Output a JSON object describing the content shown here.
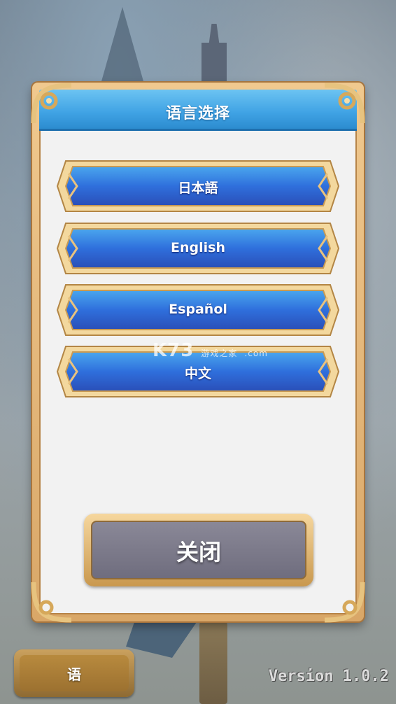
{
  "dialog": {
    "title": "语言选择",
    "languages": [
      {
        "label": "日本語"
      },
      {
        "label": "English"
      },
      {
        "label": "Español"
      },
      {
        "label": "中文"
      }
    ],
    "close_label": "关闭"
  },
  "footer": {
    "language_button_label": "语",
    "version": "Version 1.0.2"
  },
  "watermark": {
    "brand": "K73",
    "sub": "游戏之家",
    "domain": ".com"
  },
  "colors": {
    "title_bar": "#3fa2e4",
    "language_button": "#2f6fdc",
    "frame_gold": "#e8c27f",
    "close_button": "#7a7889"
  },
  "icons": {
    "corner": "gold-scroll-ornament",
    "arrow": "chevron-ornament"
  }
}
